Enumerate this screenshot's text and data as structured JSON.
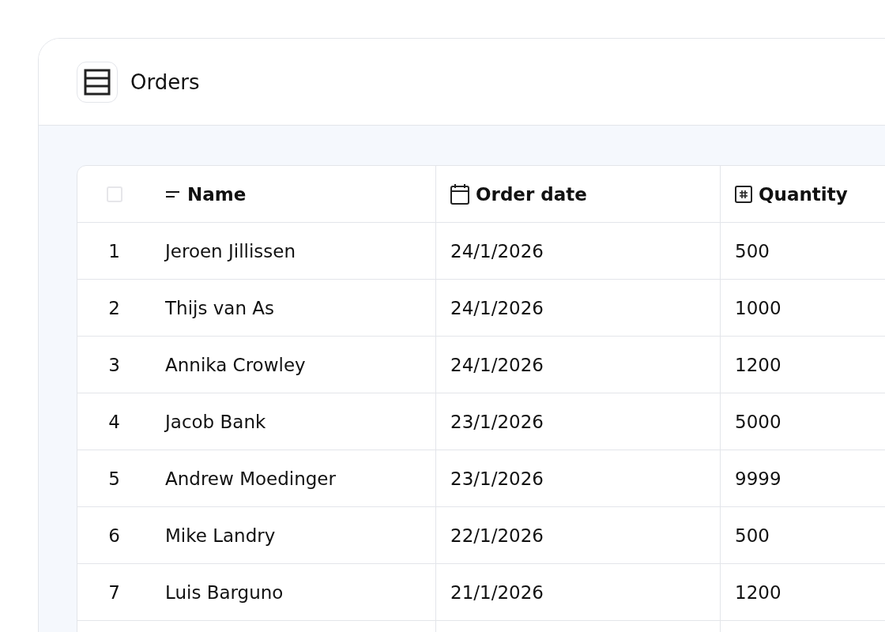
{
  "window": {
    "title": "Orders"
  },
  "table": {
    "select_all": {
      "checked": false
    },
    "columns": [
      {
        "label": "Name",
        "kind": "text"
      },
      {
        "label": "Order date",
        "kind": "date"
      },
      {
        "label": "Quantity",
        "kind": "number"
      }
    ],
    "rows": [
      {
        "index": "1",
        "cells": [
          "Jeroen Jillissen",
          "24/1/2026",
          "500"
        ]
      },
      {
        "index": "2",
        "cells": [
          "Thijs van As",
          "24/1/2026",
          "1000"
        ]
      },
      {
        "index": "3",
        "cells": [
          "Annika Crowley",
          "24/1/2026",
          "1200"
        ]
      },
      {
        "index": "4",
        "cells": [
          "Jacob Bank",
          "23/1/2026",
          "5000"
        ]
      },
      {
        "index": "5",
        "cells": [
          "Andrew Moedinger",
          "23/1/2026",
          "9999"
        ]
      },
      {
        "index": "6",
        "cells": [
          "Mike Landry",
          "22/1/2026",
          "500"
        ]
      },
      {
        "index": "7",
        "cells": [
          "Luis Barguno",
          "21/1/2026",
          "1200"
        ]
      }
    ]
  }
}
